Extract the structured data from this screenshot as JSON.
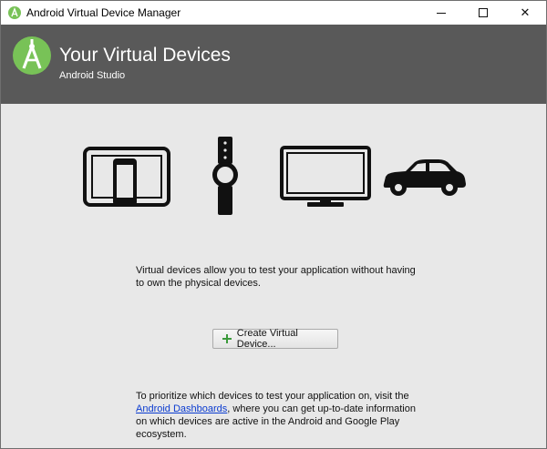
{
  "window": {
    "title": "Android Virtual Device Manager",
    "min_label": "",
    "max_label": "",
    "close_label": "✕"
  },
  "header": {
    "title": "Your Virtual Devices",
    "subtitle": "Android Studio"
  },
  "colors": {
    "header_bg": "#595959",
    "logo_green": "#78c257",
    "body_bg": "#e8e8e8",
    "link": "#0a3bd0",
    "plus_green": "#3b9a3b"
  },
  "devices": {
    "icons": [
      "tablet-phone-icon",
      "watch-icon",
      "tv-icon",
      "car-icon"
    ]
  },
  "main": {
    "intro_text": "Virtual devices allow you to test your application without having to own the physical devices.",
    "create_button_label": "Create Virtual Device...",
    "note_before_link": "To prioritize which devices to test your application on, visit the ",
    "note_link": "Android Dashboards",
    "note_after_link": ", where you can get up-to-date information on which devices are active in the Android and Google Play ecosystem."
  }
}
